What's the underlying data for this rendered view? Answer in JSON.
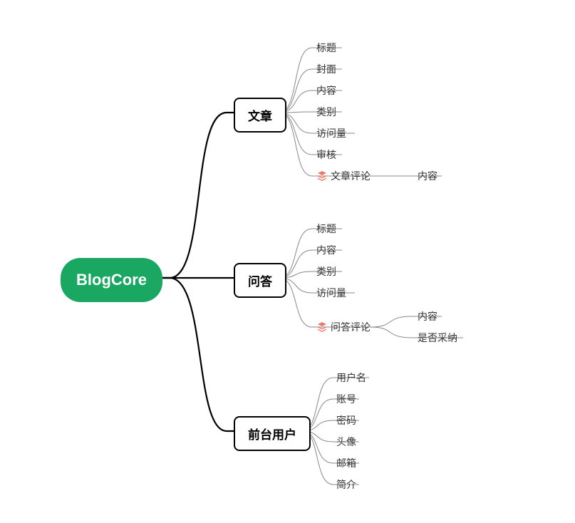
{
  "root": {
    "label": "BlogCore"
  },
  "branches": [
    {
      "id": "article",
      "label": "文章",
      "leaves": [
        {
          "label": "标题"
        },
        {
          "label": "封面"
        },
        {
          "label": "内容"
        },
        {
          "label": "类别"
        },
        {
          "label": "访问量"
        },
        {
          "label": "审核"
        },
        {
          "label": "文章评论",
          "hasIcon": true,
          "children": [
            {
              "label": "内容"
            }
          ]
        }
      ]
    },
    {
      "id": "qa",
      "label": "问答",
      "leaves": [
        {
          "label": "标题"
        },
        {
          "label": "内容"
        },
        {
          "label": "类别"
        },
        {
          "label": "访问量"
        },
        {
          "label": "问答评论",
          "hasIcon": true,
          "children": [
            {
              "label": "内容"
            },
            {
              "label": "是否采纳"
            }
          ]
        }
      ]
    },
    {
      "id": "user",
      "label": "前台用户",
      "leaves": [
        {
          "label": "用户名"
        },
        {
          "label": "账号"
        },
        {
          "label": "密码"
        },
        {
          "label": "头像"
        },
        {
          "label": "邮箱"
        },
        {
          "label": "简介"
        }
      ]
    }
  ],
  "iconColor": "#f07868"
}
